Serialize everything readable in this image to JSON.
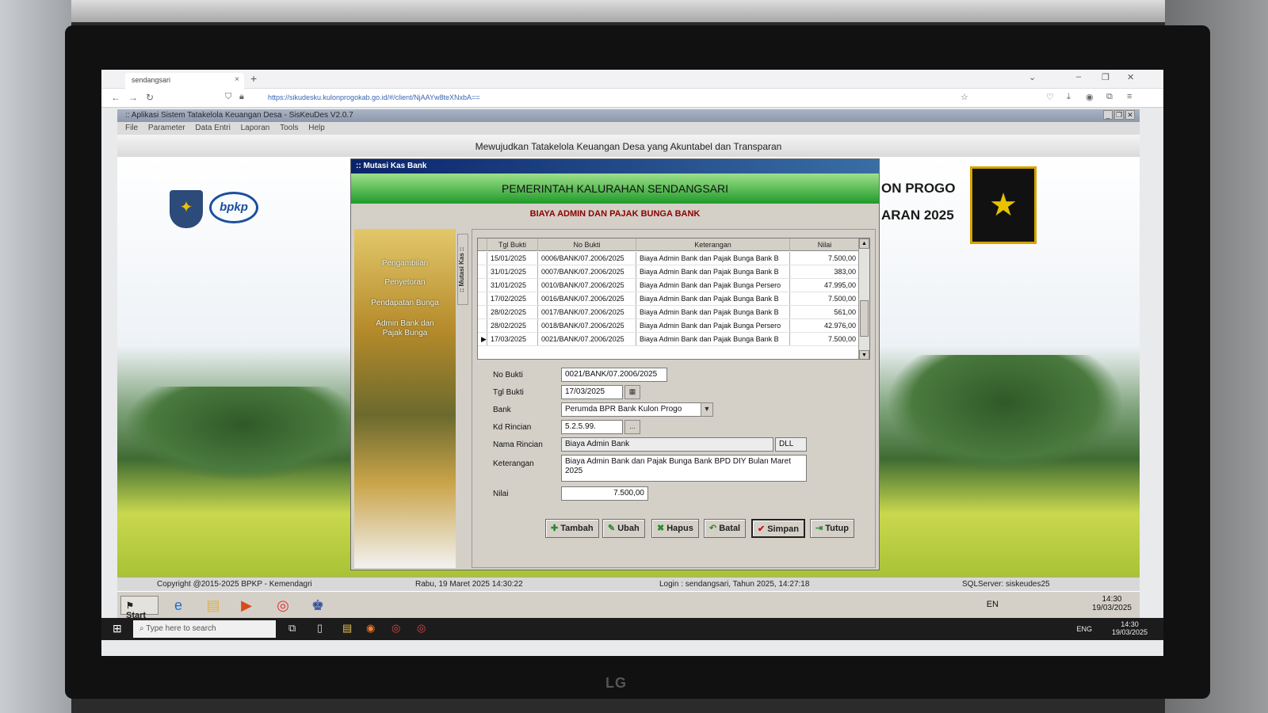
{
  "browser": {
    "tab_title": "sendangsari",
    "url": "https://sikudesku.kulonprogokab.go.id/#/client/NjAAYw8teXNxbA=="
  },
  "app": {
    "title": ":: Aplikasi Sistem Tatakelola Keuangan Desa - SisKeuDes V2.0.7",
    "menu": [
      "File",
      "Parameter",
      "Data Entri",
      "Laporan",
      "Tools",
      "Help"
    ],
    "tagline": "Mewujudkan Tatakelola Keuangan Desa yang Akuntabel dan Transparan",
    "right_line1": "ON PROGO",
    "right_line2": "ARAN 2025",
    "logo_text": "bpkp"
  },
  "dialog": {
    "title": ":: Mutasi Kas Bank",
    "banner": "PEMERINTAH KALURAHAN SENDANGSARI",
    "subtitle": "BIAYA ADMIN DAN PAJAK BUNGA BANK",
    "side_tab": ":: Mutasi Kas ::",
    "side_menu": [
      "Pengambilan",
      "Penyetoran",
      "Pendapatan Bunga",
      "Admin Bank dan Pajak Bunga"
    ],
    "grid": {
      "headers": [
        "Tgl Bukti",
        "No Bukti",
        "Keterangan",
        "Nilai"
      ],
      "rows": [
        {
          "tgl": "15/01/2025",
          "no": "0006/BANK/07.2006/2025",
          "ket": "Biaya Admin Bank dan Pajak Bunga Bank B",
          "nilai": "7.500,00"
        },
        {
          "tgl": "31/01/2025",
          "no": "0007/BANK/07.2006/2025",
          "ket": "Biaya Admin Bank dan Pajak Bunga Bank B",
          "nilai": "383,00"
        },
        {
          "tgl": "31/01/2025",
          "no": "0010/BANK/07.2006/2025",
          "ket": "Biaya Admin Bank dan Pajak Bunga Persero",
          "nilai": "47.995,00"
        },
        {
          "tgl": "17/02/2025",
          "no": "0016/BANK/07.2006/2025",
          "ket": "Biaya Admin Bank dan Pajak Bunga Bank B",
          "nilai": "7.500,00"
        },
        {
          "tgl": "28/02/2025",
          "no": "0017/BANK/07.2006/2025",
          "ket": "Biaya Admin Bank dan Pajak Bunga Bank B",
          "nilai": "561,00"
        },
        {
          "tgl": "28/02/2025",
          "no": "0018/BANK/07.2006/2025",
          "ket": "Biaya Admin Bank dan Pajak Bunga Persero",
          "nilai": "42.976,00"
        },
        {
          "tgl": "17/03/2025",
          "no": "0021/BANK/07.2006/2025",
          "ket": "Biaya Admin Bank dan Pajak Bunga Bank B",
          "nilai": "7.500,00"
        }
      ],
      "selected_index": 6
    },
    "form": {
      "no_bukti_label": "No Bukti",
      "no_bukti": "0021/BANK/07.2006/2025",
      "tgl_bukti_label": "Tgl Bukti",
      "tgl_bukti": "17/03/2025",
      "bank_label": "Bank",
      "bank": "Perumda BPR Bank Kulon Progo",
      "kd_rincian_label": "Kd Rincian",
      "kd_rincian": "5.2.5.99.",
      "nama_rincian_label": "Nama Rincian",
      "nama_rincian": "Biaya Admin Bank",
      "nama_rincian_code": "DLL",
      "keterangan_label": "Keterangan",
      "keterangan": "Biaya Admin Bank dan Pajak Bunga Bank BPD DIY Bulan Maret 2025",
      "nilai_label": "Nilai",
      "nilai": "7.500,00",
      "browse_label": "..."
    },
    "buttons": {
      "tambah": "Tambah",
      "ubah": "Ubah",
      "hapus": "Hapus",
      "batal": "Batal",
      "simpan": "Simpan",
      "tutup": "Tutup"
    }
  },
  "status": {
    "copyright": "Copyright @2015-2025 BPKP - Kemendagri",
    "datetime": "Rabu, 19 Maret 2025  14:30:22",
    "login": "Login : sendangsari,  Tahun 2025, 14:27:18",
    "server": "SQLServer: siskeudes25"
  },
  "inner_taskbar": {
    "start": "Start",
    "lang": "EN",
    "time": "14:30",
    "date": "19/03/2025"
  },
  "win_taskbar": {
    "search_placeholder": "Type here to search",
    "lang": "ENG",
    "time": "14:30",
    "date": "19/03/2025"
  },
  "monitor_brand": "LG"
}
